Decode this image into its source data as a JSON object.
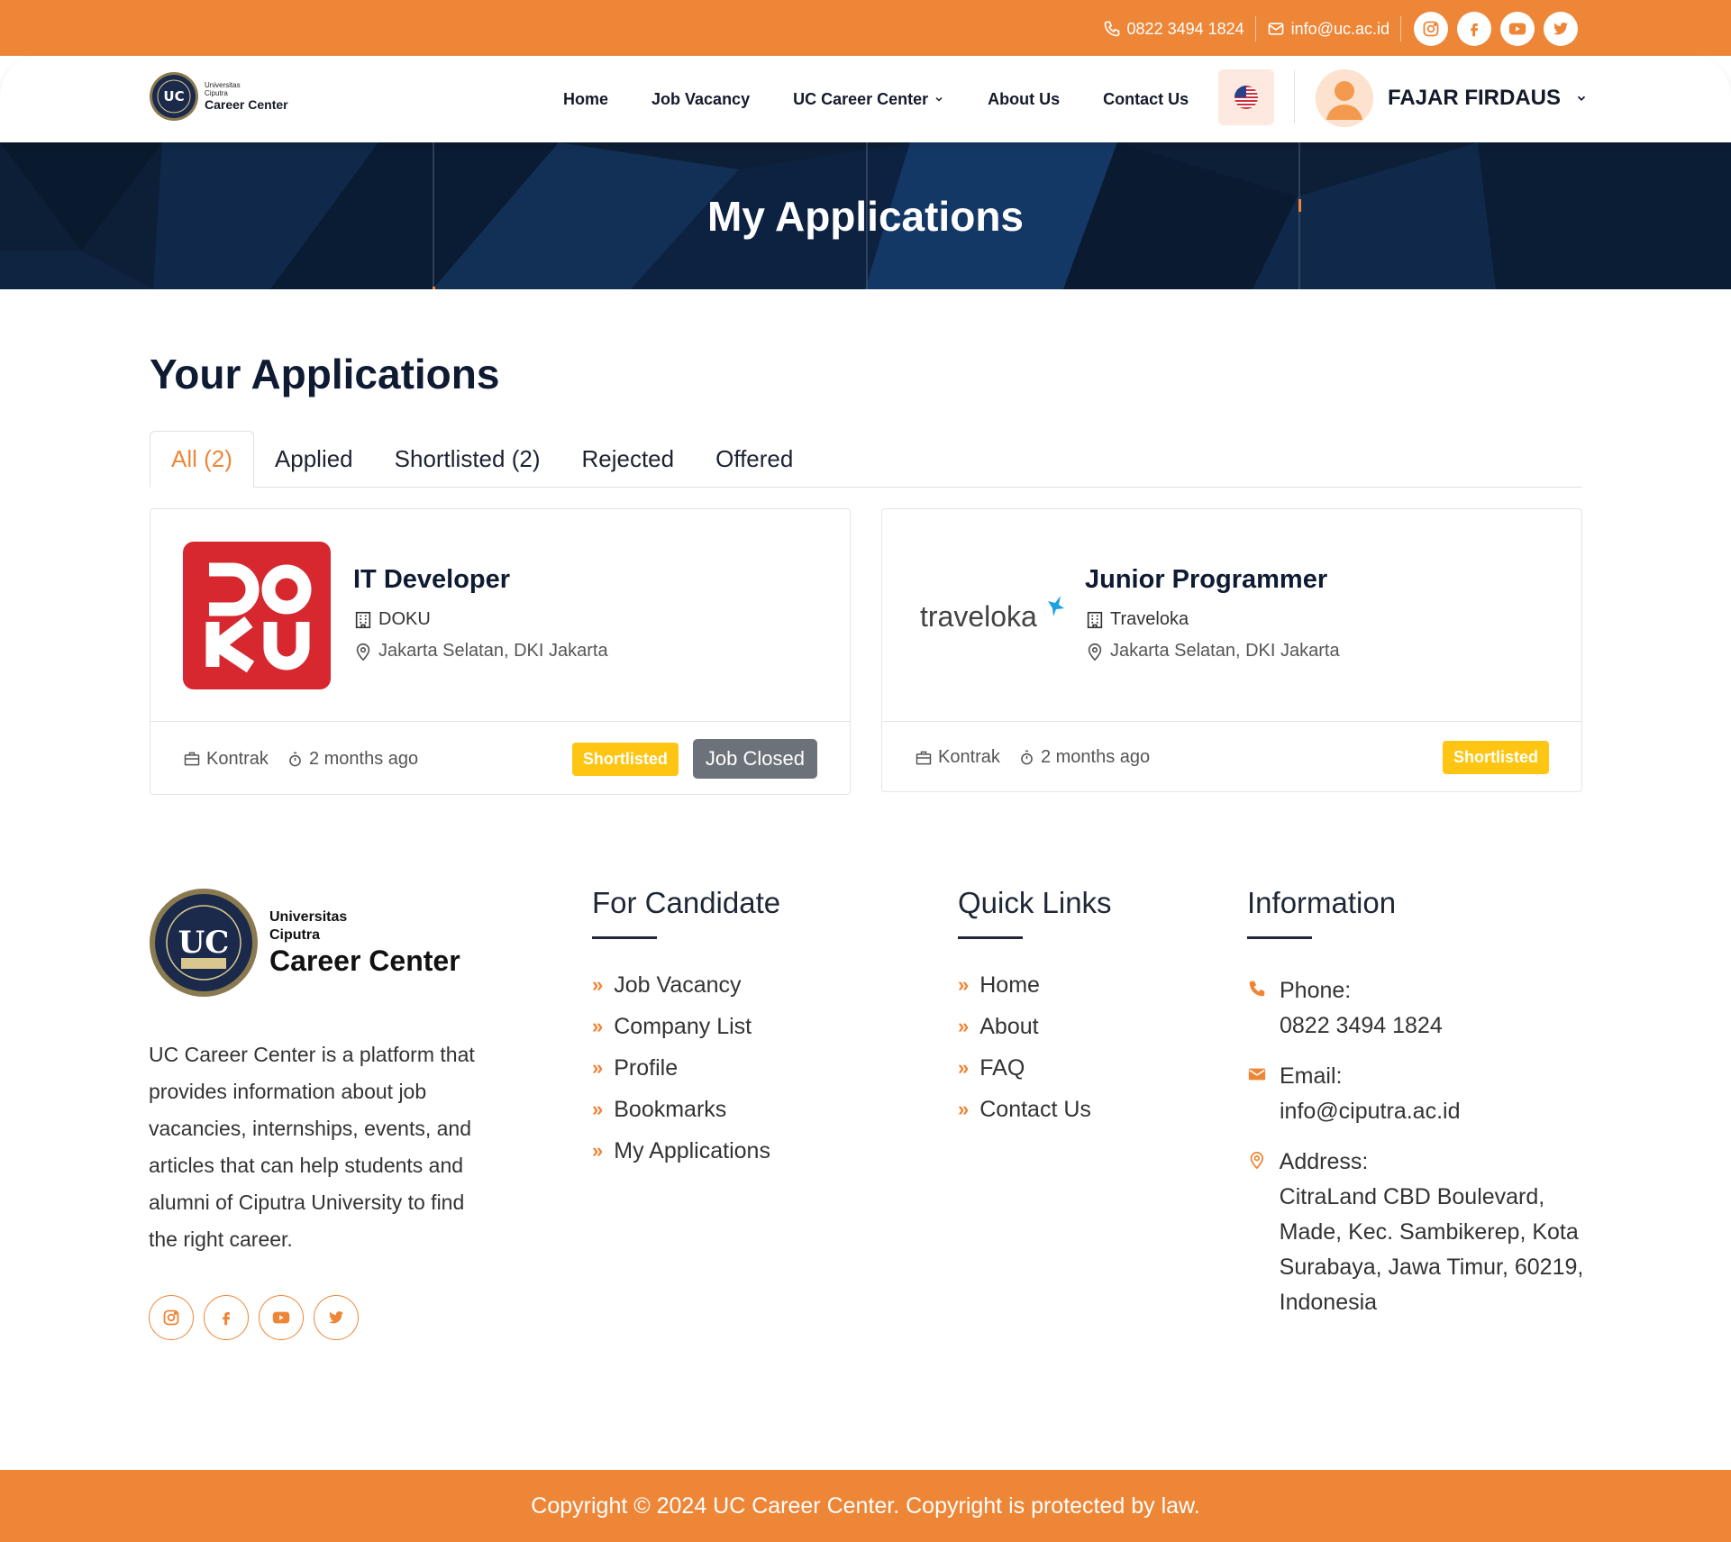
{
  "topbar": {
    "phone": "0822 3494 1824",
    "email": "info@uc.ac.id",
    "social": [
      "instagram-icon",
      "facebook-icon",
      "youtube-icon",
      "twitter-icon"
    ]
  },
  "header": {
    "logo_line1": "Universitas",
    "logo_line2": "Ciputra",
    "logo_line3": "Career Center",
    "nav": [
      "Home",
      "Job Vacancy",
      "UC Career Center",
      "About Us",
      "Contact Us"
    ],
    "user_name": "FAJAR FIRDAUS"
  },
  "hero": {
    "title": "My Applications"
  },
  "main": {
    "title": "Your Applications",
    "tabs": [
      "All (2)",
      "Applied",
      "Shortlisted (2)",
      "Rejected",
      "Offered"
    ],
    "cards": [
      {
        "title": "IT Developer",
        "company": "DOKU",
        "location": "Jakarta Selatan, DKI Jakarta",
        "type": "Kontrak",
        "time": "2 months ago",
        "status": "Shortlisted",
        "closed": "Job Closed"
      },
      {
        "title": "Junior Programmer",
        "company": "Traveloka",
        "location": "Jakarta Selatan, DKI Jakarta",
        "type": "Kontrak",
        "time": "2 months ago",
        "status": "Shortlisted"
      }
    ]
  },
  "footer": {
    "logo_line1": "Universitas",
    "logo_line2": "Ciputra",
    "logo_line3": "Career Center",
    "about": "UC Career Center is a platform that provides information about job vacancies, internships, events, and articles that can help students and alumni of Ciputra University to find the right career.",
    "candidate_title": "For Candidate",
    "candidate_links": [
      "Job Vacancy",
      "Company List",
      "Profile",
      "Bookmarks",
      "My Applications"
    ],
    "quick_title": "Quick Links",
    "quick_links": [
      "Home",
      "About",
      "FAQ",
      "Contact Us"
    ],
    "info_title": "Information",
    "phone_label": "Phone:",
    "phone": "0822 3494 1824",
    "email_label": "Email:",
    "email": "info@ciputra.ac.id",
    "address_label": "Address:",
    "address": "CitraLand CBD Boulevard, Made, Kec. Sambikerep, Kota Surabaya, Jawa Timur, 60219, Indonesia",
    "copyright": "Copyright © 2024 UC Career Center. Copyright is protected by law."
  },
  "colors": {
    "accent": "#ee8637",
    "dark": "#0f1b33",
    "badge": "#fec613",
    "closed": "#6c7279"
  }
}
